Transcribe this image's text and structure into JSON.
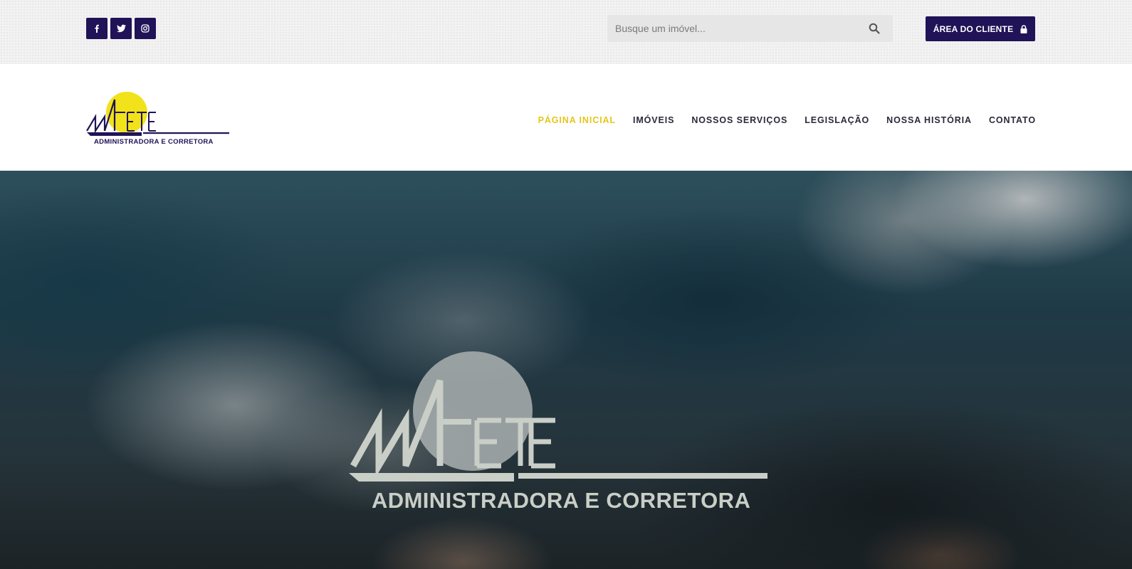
{
  "topbar": {
    "social": [
      {
        "name": "facebook-icon"
      },
      {
        "name": "twitter-icon"
      },
      {
        "name": "instagram-icon"
      }
    ],
    "search": {
      "placeholder": "Busque um imóvel...",
      "icon": "search-icon"
    },
    "client_button": {
      "label": "ÁREA DO CLIENTE",
      "icon": "lock-icon"
    }
  },
  "header": {
    "logo": {
      "wordmark": "MAETE",
      "caption": "ADMINISTRADORA E CORRETORA"
    },
    "nav": [
      {
        "label": "PÁGINA INICIAL",
        "active": true
      },
      {
        "label": "IMÓVEIS",
        "active": false
      },
      {
        "label": "NOSSOS SERVIÇOS",
        "active": false
      },
      {
        "label": "LEGISLAÇÃO",
        "active": false
      },
      {
        "label": "NOSSA HISTÓRIA",
        "active": false
      },
      {
        "label": "CONTATO",
        "active": false
      }
    ]
  },
  "hero": {
    "logo": {
      "wordmark": "MAETE",
      "caption": "ADMINISTRADORA E CORRETORA"
    }
  },
  "colors": {
    "brand_primary": "#201357",
    "brand_accent": "#e6c619",
    "nav_text": "#2a2a3a",
    "topbar_bg": "#f2f2f2"
  }
}
